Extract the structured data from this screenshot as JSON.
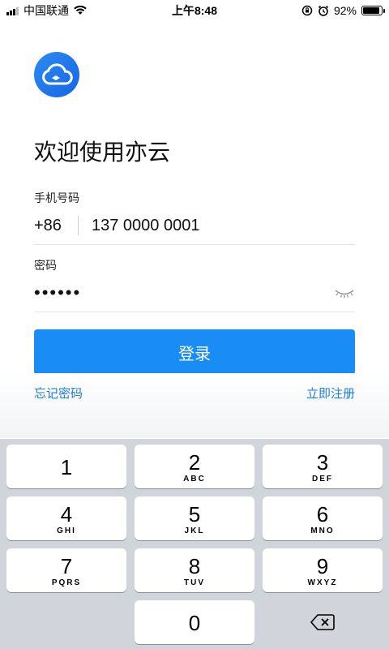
{
  "status_bar": {
    "carrier": "中国联通",
    "time": "上午8:48",
    "battery": "92%",
    "battery_level": 0.92
  },
  "app": {
    "logo_icon": "cloud-icon",
    "title": "欢迎使用亦云"
  },
  "form": {
    "phone_label": "手机号码",
    "country_code": "+86",
    "phone_value": "137 0000 0001",
    "password_label": "密码",
    "password_value": "••••••",
    "toggle_icon": "closed-eye-icon",
    "login_label": "登录",
    "forgot_label": "忘记密码",
    "register_label": "立即注册"
  },
  "keypad": {
    "keys": [
      {
        "num": "1",
        "letters": ""
      },
      {
        "num": "2",
        "letters": "ABC"
      },
      {
        "num": "3",
        "letters": "DEF"
      },
      {
        "num": "4",
        "letters": "GHI"
      },
      {
        "num": "5",
        "letters": "JKL"
      },
      {
        "num": "6",
        "letters": "MNO"
      },
      {
        "num": "7",
        "letters": "PQRS"
      },
      {
        "num": "8",
        "letters": "TUV"
      },
      {
        "num": "9",
        "letters": "WXYZ"
      },
      {
        "num": "0",
        "letters": ""
      }
    ],
    "delete_icon": "backspace-icon"
  },
  "colors": {
    "accent": "#1a8cf5",
    "link": "#1a7de0",
    "keypad_bg": "#d1d4da"
  }
}
